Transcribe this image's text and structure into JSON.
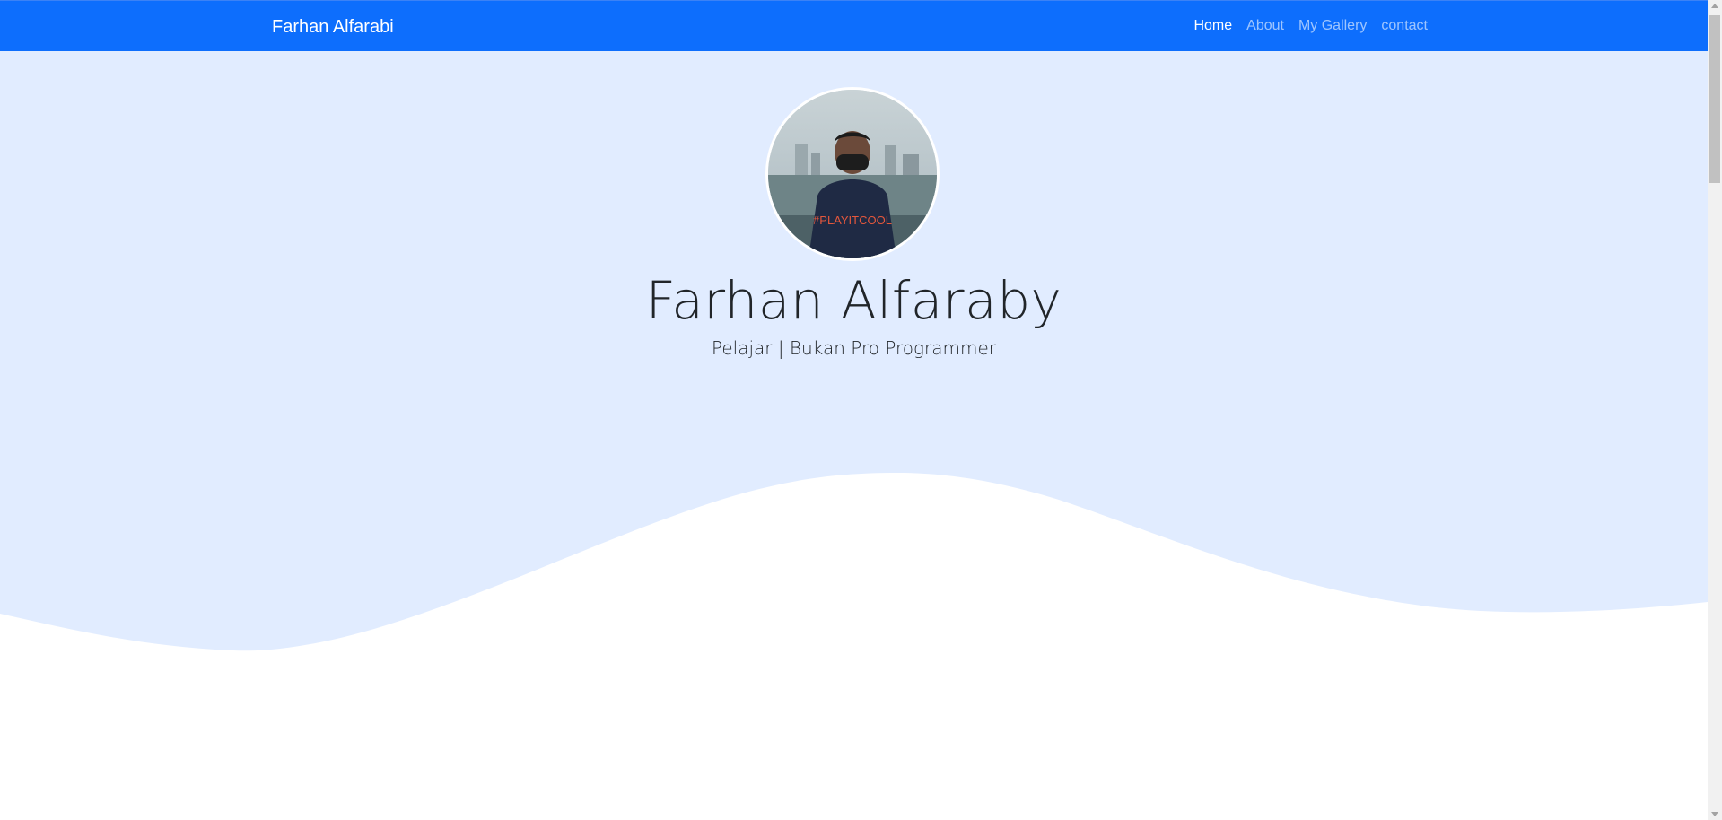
{
  "navbar": {
    "brand": "Farhan Alfarabi",
    "items": [
      {
        "label": "Home",
        "active": true
      },
      {
        "label": "About",
        "active": false
      },
      {
        "label": "My Gallery",
        "active": false
      },
      {
        "label": "contact",
        "active": false
      }
    ]
  },
  "hero": {
    "name": "Farhan Alfaraby",
    "subtitle": "Pelajar | Bukan Pro Programmer",
    "avatar_shirt_text": "#PLAYITCOOL"
  },
  "colors": {
    "navbar_bg": "#0d6efd",
    "hero_bg": "#e1ecff",
    "wave": "#ffffff"
  }
}
